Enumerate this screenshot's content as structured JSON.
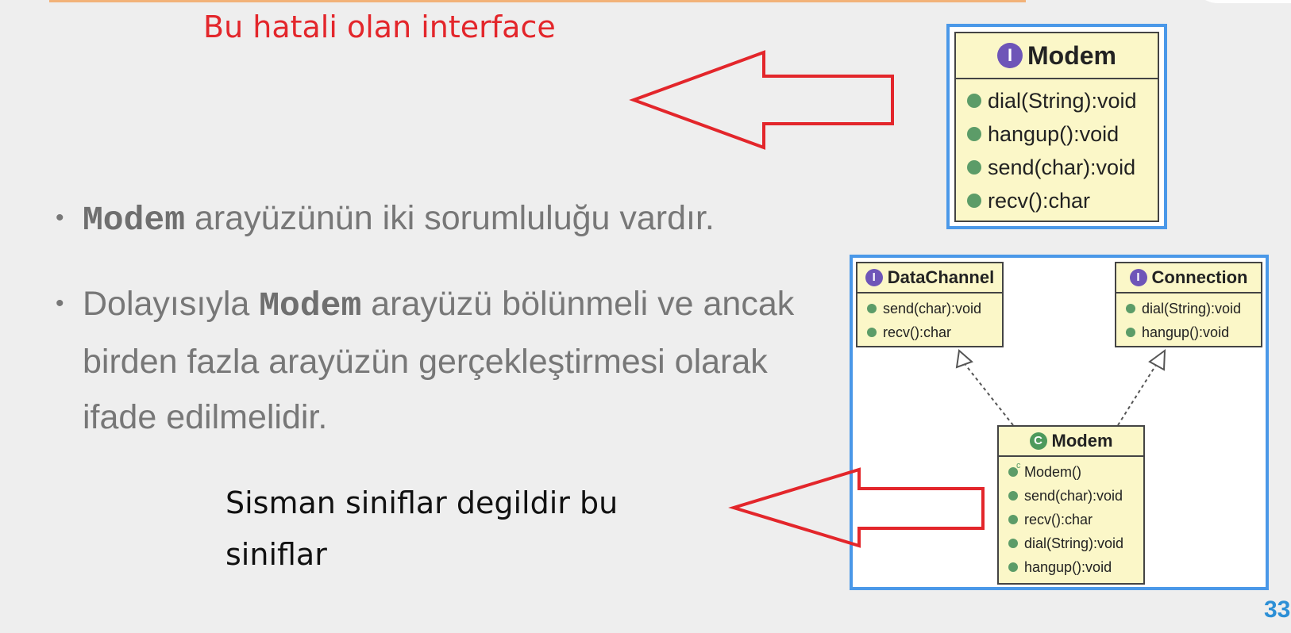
{
  "annotations": {
    "top_red": "Bu hatali olan interface",
    "bottom_black": "Sisman siniflar degildir bu siniflar"
  },
  "bullets": [
    {
      "code": "Modem",
      "text_after": " arayüzünün iki sorumluluğu vardır."
    },
    {
      "text_before": "Dolayısıyla ",
      "code": "Modem",
      "text_after": " arayüzü bölünmeli ve ancak birden fazla arayüzün gerçekleştirmesi olarak ifade edilmelidir."
    }
  ],
  "uml_top": {
    "name": "Modem",
    "stereotype": "I",
    "members": [
      "dial(String):void",
      "hangup():void",
      "send(char):void",
      "recv():char"
    ]
  },
  "uml_bottom": {
    "datachannel": {
      "name": "DataChannel",
      "stereotype": "I",
      "members": [
        "send(char):void",
        "recv():char"
      ]
    },
    "connection": {
      "name": "Connection",
      "stereotype": "I",
      "members": [
        "dial(String):void",
        "hangup():void"
      ]
    },
    "modem": {
      "name": "Modem",
      "stereotype": "C",
      "members": [
        "Modem()",
        "send(char):void",
        "recv():char",
        "dial(String):void",
        "hangup():void"
      ]
    }
  },
  "page_number": "33",
  "colors": {
    "annotation_red": "#e3262b",
    "frame_blue": "#4a98e8",
    "uml_fill": "#fbf7c8"
  }
}
